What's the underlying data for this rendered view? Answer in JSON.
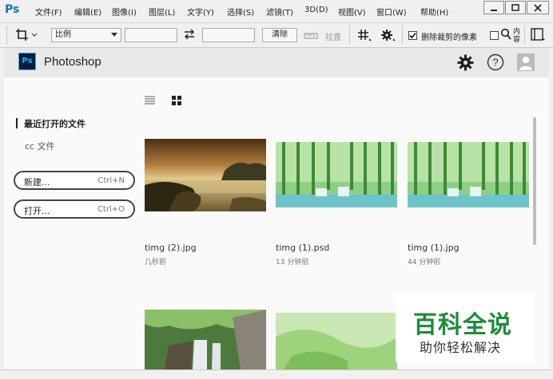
{
  "app": {
    "logo": "Ps"
  },
  "menu": [
    "文件(F)",
    "编辑(E)",
    "图像(I)",
    "图层(L)",
    "文字(Y)",
    "选择(S)",
    "滤镜(T)",
    "3D(D)",
    "视图(V)",
    "窗口(W)",
    "帮助(H)"
  ],
  "window_controls": [
    "minimize-icon",
    "maximize-icon",
    "close-icon"
  ],
  "options": {
    "tool_icon": "crop-icon",
    "ratio_select": "比例",
    "width_value": "",
    "swap_icon": "swap-icon",
    "height_value": "",
    "clear_label": "清除",
    "straighten_label": "拉直",
    "overlay_icon": "grid-icon",
    "settings_icon": "gear-icon",
    "delete_cropped_checked": true,
    "delete_cropped_label": "删除裁剪的像素",
    "content_aware_label": "内",
    "content_aware_checked": false,
    "search_icon": "search-icon",
    "search_text": "容"
  },
  "home": {
    "title": "Photoshop",
    "badge": "Ps",
    "header_icons": [
      "gear-icon",
      "help-icon",
      "user-icon"
    ]
  },
  "sidebar": {
    "recent": "最近打开的文件",
    "cc_files": "cc 文件",
    "new_label": "新建...",
    "new_shortcut": "Ctrl+N",
    "open_label": "打开...",
    "open_shortcut": "Ctrl+O"
  },
  "view_toggle": {
    "list_icon": "list-view-icon",
    "grid_icon": "grid-view-icon",
    "active": "grid"
  },
  "files": [
    {
      "name": "timg (2).jpg",
      "time": "几秒前"
    },
    {
      "name": "timg (1).psd",
      "time": "13 分钟前"
    },
    {
      "name": "timg (1).jpg",
      "time": "44 分钟前"
    },
    {
      "name": "",
      "time": ""
    },
    {
      "name": "",
      "time": ""
    }
  ],
  "watermark": {
    "big": "百科全说",
    "small": "助你轻松解决"
  },
  "colors": {
    "ps_blue": "#31a8ff",
    "ps_dark": "#001e36",
    "watermark_green": "#1f8c3a"
  }
}
